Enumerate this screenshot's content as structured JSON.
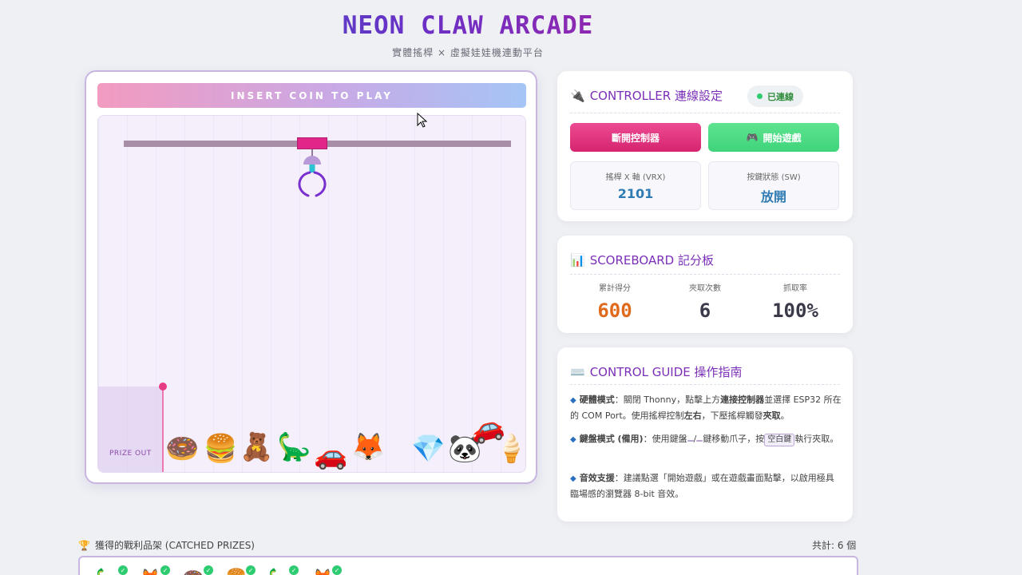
{
  "header": {
    "title": "NEON CLAW ARCADE",
    "subtitle": "實體搖桿 × 虛擬娃娃機連動平台"
  },
  "game": {
    "coin_banner": "INSERT COIN TO PLAY",
    "chute_label": "PRIZE OUT",
    "prizes": [
      "🍩",
      "🍔",
      "🧸",
      "🦕",
      "🚗",
      "🦊",
      "💎",
      "🐼",
      "🚗",
      "🍦"
    ]
  },
  "controller": {
    "icon": "🔌",
    "title": "CONTROLLER 連線設定",
    "status": "已連線",
    "status_color": "#2ecc71",
    "disconnect_label": "斷開控制器",
    "start_label": "開始遊戲",
    "start_icon": "🎮",
    "vrx_label": "搖桿 X 軸 (VRX)",
    "vrx_value": "2101",
    "sw_label": "按鍵狀態 (SW)",
    "sw_value": "放開"
  },
  "scoreboard": {
    "icon": "📊",
    "title": "SCOREBOARD 記分板",
    "total_label": "累計得分",
    "total_value": "600",
    "total_color": "#e06a1c",
    "catches_label": "夾取次數",
    "catches_value": "6",
    "rate_label": "抓取率",
    "rate_value": "100%"
  },
  "guide": {
    "icon": "⌨️",
    "title": "CONTROL GUIDE 操作指南",
    "item1_head": "硬體模式",
    "item1_text1": "：關閉 Thonny，點擊上方",
    "item1_bold1": "連接控制器",
    "item1_text2": "並選擇 ESP32 所在的 COM Port。使用搖桿控制",
    "item1_bold2": "左右",
    "item1_text3": "，下壓搖桿觸發",
    "item1_bold3": "夾取",
    "item1_text4": "。",
    "item2_head": "鍵盤模式 (備用)",
    "item2_text1": "：使用鍵盤",
    "item2_key1": " ",
    "item2_sep": "/",
    "item2_key2": " ",
    "item2_text2": "鍵移動爪子，按",
    "item2_key3": "空白鍵",
    "item2_text3": "執行夾取。",
    "item3_head": "音效支援",
    "item3_text": "：建議點選「開始遊戲」或在遊戲畫面點擊，以啟用極具臨場感的瀏覽器 8-bit 音效。"
  },
  "prizes_section": {
    "icon": "🏆",
    "title": "獲得的戰利品架 (CATCHED PRIZES)",
    "count": "共計: 6 個",
    "items": [
      "🦕",
      "🦊",
      "🍩",
      "🍔",
      "🦕",
      "🦊"
    ]
  }
}
